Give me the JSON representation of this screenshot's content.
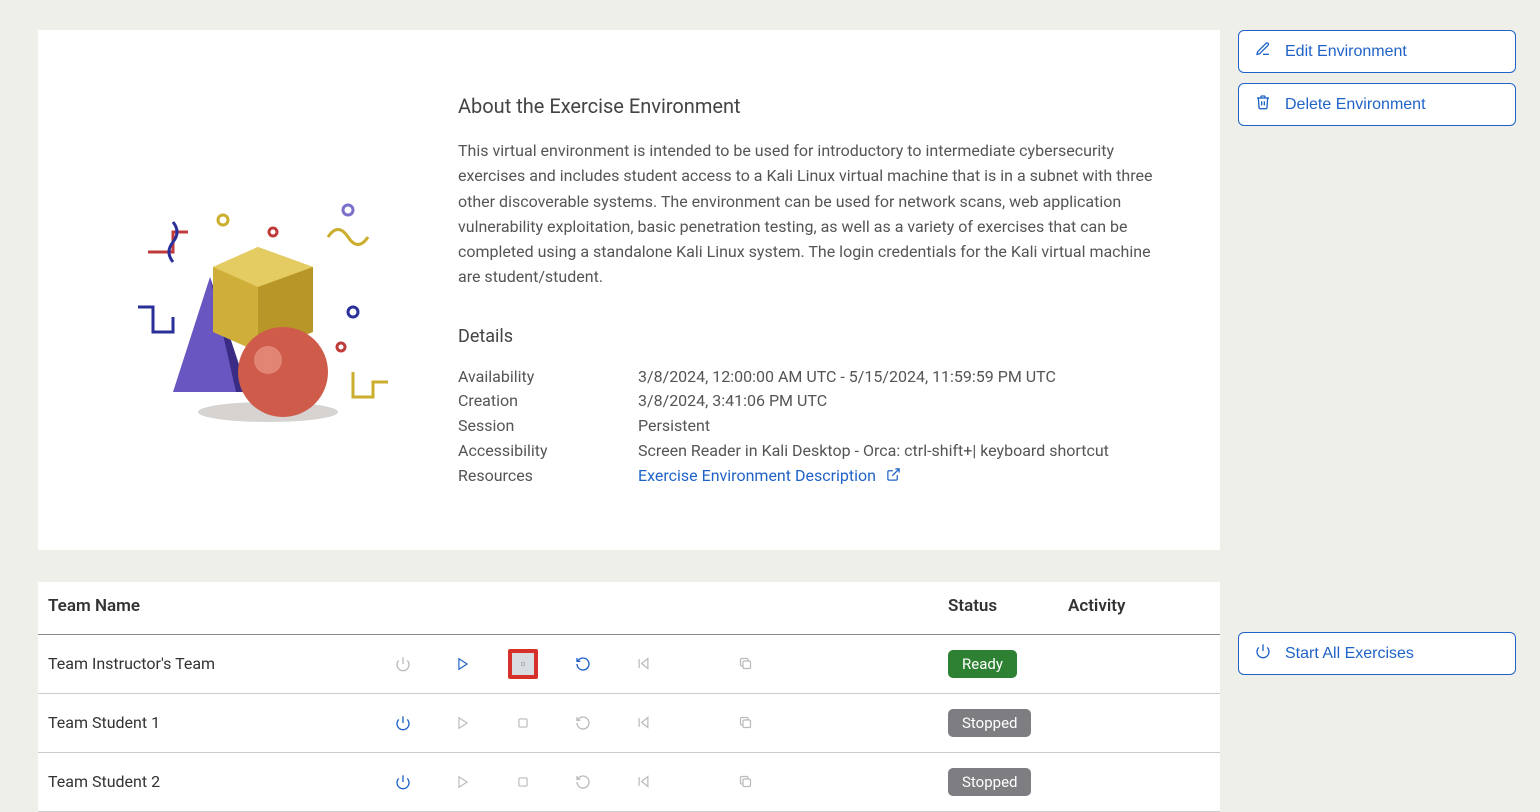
{
  "about": {
    "heading": "About the Exercise Environment",
    "description": "This virtual environment is intended to be used for introductory to intermediate cybersecurity exercises and includes student access to a Kali Linux virtual machine that is in a subnet with three other discoverable systems. The environment can be used for network scans, web application vulnerability exploitation, basic penetration testing, as well as a variety of exercises that can be completed using a standalone Kali Linux system. The login credentials for the Kali virtual machine are student/student."
  },
  "details": {
    "heading": "Details",
    "labels": {
      "availability": "Availability",
      "creation": "Creation",
      "session": "Session",
      "accessibility": "Accessibility",
      "resources": "Resources"
    },
    "values": {
      "availability": "3/8/2024, 12:00:00 AM UTC - 5/15/2024, 11:59:59 PM UTC",
      "creation": "3/8/2024, 3:41:06 PM UTC",
      "session": "Persistent",
      "accessibility": "Screen Reader in Kali Desktop - Orca: ctrl-shift+| keyboard shortcut",
      "resources_link": "Exercise Environment Description"
    }
  },
  "sidebar": {
    "edit_label": "Edit Environment",
    "delete_label": "Delete Environment",
    "start_all_label": "Start All Exercises"
  },
  "table": {
    "headers": {
      "team_name": "Team Name",
      "status": "Status",
      "activity": "Activity"
    },
    "rows": [
      {
        "name": "Team Instructor's Team",
        "status": "Ready",
        "status_class": "ready",
        "stop_highlight": true
      },
      {
        "name": "Team Student 1",
        "status": "Stopped",
        "status_class": "stopped",
        "stop_highlight": false
      },
      {
        "name": "Team Student 2",
        "status": "Stopped",
        "status_class": "stopped",
        "stop_highlight": false
      }
    ]
  }
}
